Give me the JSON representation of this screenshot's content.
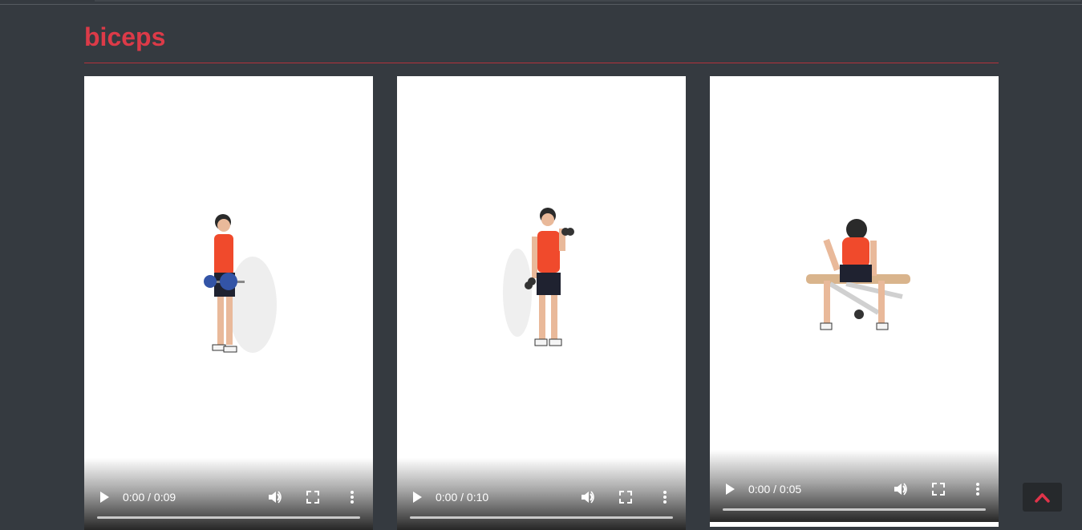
{
  "section": {
    "title": "biceps"
  },
  "videos": [
    {
      "time": "0:00 / 0:09"
    },
    {
      "time": "0:00 / 0:10"
    },
    {
      "time": "0:00 / 0:05"
    }
  ],
  "colors": {
    "accent": "#dc3a48",
    "background": "#353a40",
    "card": "#ffffff",
    "shirt": "#f04a2c"
  },
  "icons": [
    "play-icon",
    "volume-icon",
    "fullscreen-icon",
    "more-options-icon",
    "chevron-up-icon"
  ]
}
